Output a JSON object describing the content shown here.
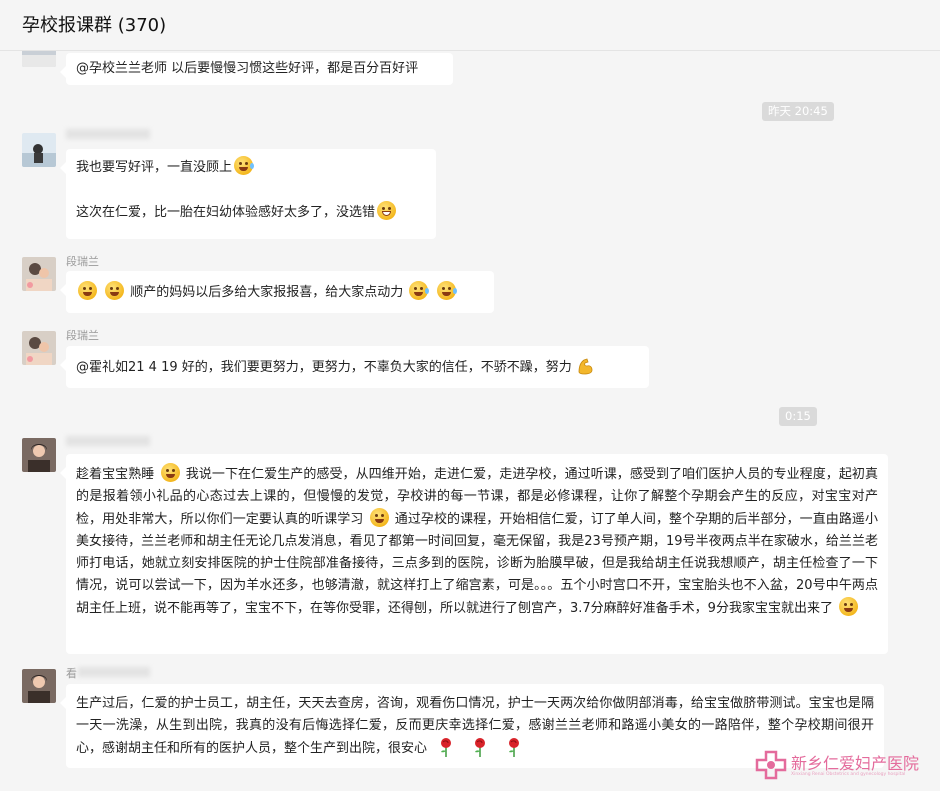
{
  "header": {
    "title": "孕校报课群 (370)"
  },
  "timestamps": {
    "t1": "昨天 20:45",
    "t2": "0:15"
  },
  "senders": {
    "s1": "段瑞兰",
    "s2": "段瑞兰",
    "s3": "看"
  },
  "messages": {
    "m0": "@孕校兰兰老师 以后要慢慢习惯这些好评，都是百分百好评",
    "m1_line1": "我也要写好评，一直没顾上",
    "m1_line2": "这次在仁爱，比一胎在妇幼体验感好太多了，没选错",
    "m2": "顺产的妈妈以后多给大家报报喜，给大家点动力",
    "m3": "@霍礼如21  4  19 好的，我们要更努力，更努力，不辜负大家的信任，不骄不躁，努力",
    "m4_a": "趁着宝宝熟睡",
    "m4_b": "我说一下在仁爱生产的感受，从四维开始，走进仁爱，走进孕校，通过听课，感受到了咱们医护人员的专业程度，起初真的是报着领小礼品的心态过去上课的，但慢慢的发觉，孕校讲的每一节课，都是必修课程，让你了解整个孕期会产生的反应，对宝宝对产检，用处非常大，所以你们一定要认真的听课学习",
    "m4_c": "通过孕校的课程，开始相信仁爱，订了单人间，整个孕期的后半部分，一直由路遥小美女接待，兰兰老师和胡主任无论几点发消息，看见了都第一时间回复，毫无保留，我是23号预产期，19号半夜两点半在家破水，给兰兰老师打电话，她就立刻安排医院的护士住院部准备接待，三点多到的医院，诊断为胎膜早破，但是我给胡主任说我想顺产，胡主任检查了一下情况，说可以尝试一下，因为羊水还多，也够清澈，就这样打上了缩宫素，可是。。。五个小时宫口不开，宝宝胎头也不入盆，20号中午两点胡主任上班，说不能再等了，宝宝不下，在等你受罪，还得刨，所以就进行了刨宫产，3.7分麻醉好准备手术，9分我家宝宝就出来了",
    "m5": "生产过后，仁爱的护士员工，胡主任，天天去查房，咨询，观看伤口情况，护士一天两次给你做阴部消毒，给宝宝做脐带测试。宝宝也是隔一天一洗澡，从生到出院，我真的没有后悔选择仁爱，反而更庆幸选择仁爱，感谢兰兰老师和路遥小美女的一路陪伴，整个孕校期间很开心，感谢胡主任和所有的医护人员，整个生产到出院，很安心"
  },
  "watermark": {
    "name": "新乡仁爱妇产医院",
    "sub": "Xinxiang Renai Obstetrics and gynecology hospital"
  },
  "icons": [
    "avatar-image",
    "grin-sweat-emoji",
    "grin-teeth-emoji",
    "dizzy-emoji",
    "crying-laughing-emoji",
    "flexed-biceps-icon",
    "baby-emoji",
    "smirk-emoji",
    "hot-face-emoji",
    "rose-icon",
    "hospital-cross-logo"
  ]
}
